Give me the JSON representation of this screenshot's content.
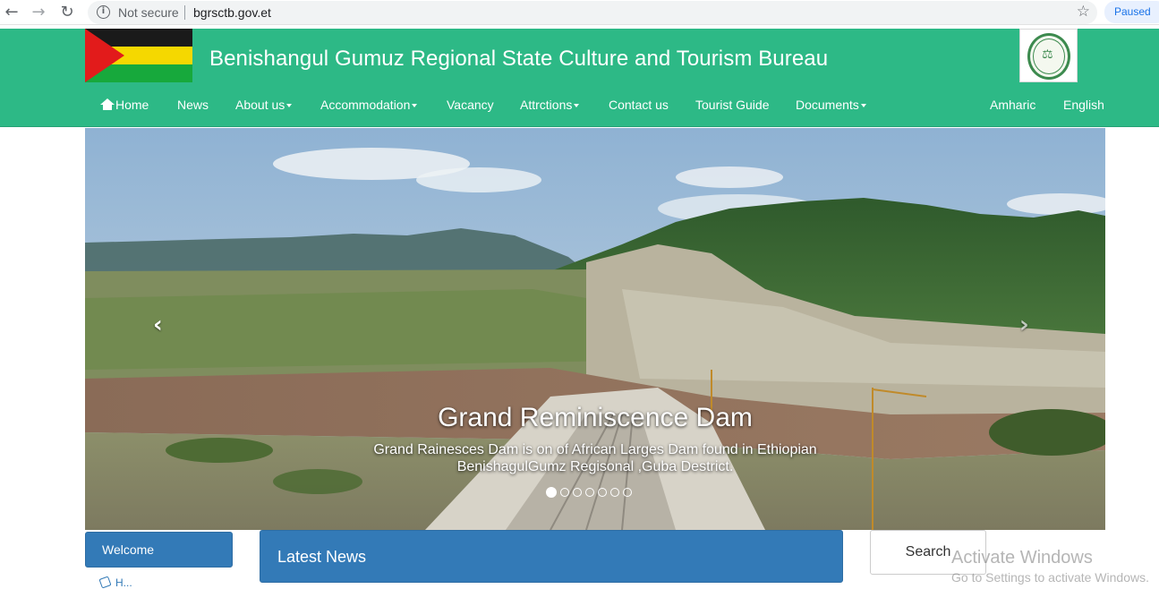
{
  "browser": {
    "back_glyph": "←",
    "forward_glyph": "→",
    "reload_glyph": "↻",
    "info_glyph": "i",
    "security_label": "Not secure",
    "url": "bgrsctb.gov.et",
    "star_glyph": "☆",
    "profile_status": "Paused"
  },
  "header": {
    "title": "Benishangul Gumuz Regional State Culture and Tourism Bureau",
    "flag_colors": {
      "top": "#1a1a1a",
      "middle": "#f5d800",
      "bottom": "#17a93c",
      "triangle": "#e21b1b"
    },
    "emblem_glyph": "⚖",
    "background": "#2db986"
  },
  "nav": {
    "items": [
      {
        "label": "Home",
        "icon": "home-icon",
        "has_dropdown": false
      },
      {
        "label": "News",
        "has_dropdown": false
      },
      {
        "label": "About us",
        "has_dropdown": true
      },
      {
        "label": "Accommodation",
        "has_dropdown": true
      },
      {
        "label": "Vacancy",
        "has_dropdown": false
      },
      {
        "label": "Attrctions",
        "has_dropdown": true
      },
      {
        "label": "Contact us",
        "has_dropdown": false
      },
      {
        "label": "Tourist Guide",
        "has_dropdown": false
      },
      {
        "label": "Documents",
        "has_dropdown": true
      }
    ],
    "languages": [
      "Amharic",
      "English"
    ]
  },
  "carousel": {
    "prev_glyph": "‹",
    "next_glyph": "›",
    "slide_title": "Grand Reminiscence Dam",
    "slide_text": "Grand Rainesces Dam is on of African Larges Dam found in Ethiopian BenishagulGumz Regisonal ,Guba Destrict.",
    "slide_count": 7,
    "active_index": 0
  },
  "panels": {
    "welcome_label": "Welcome",
    "welcome_sub": "H...",
    "news_title": "Latest News",
    "search_label": "Search"
  },
  "watermark": {
    "title": "Activate Windows",
    "subtitle": "Go to Settings to activate Windows."
  }
}
